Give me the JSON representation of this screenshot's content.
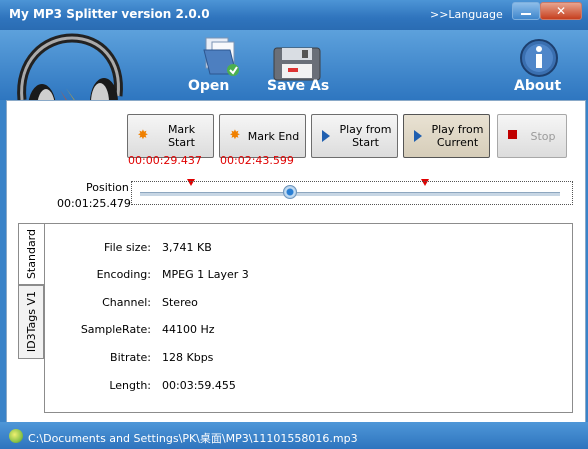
{
  "window": {
    "title": "My MP3 Splitter version 2.0.0",
    "language_label": ">>Language",
    "close_glyph": "✕"
  },
  "toolbar": {
    "open_label": "Open",
    "save_as_label": "Save As",
    "about_label": "About"
  },
  "controls": {
    "mark_start": {
      "label": "Mark Start",
      "time": "00:00:29.437"
    },
    "mark_end": {
      "label": "Mark End",
      "time": "00:02:43.599"
    },
    "play_from_start": {
      "label": "Play from Start"
    },
    "play_from_current": {
      "label": "Play from Current"
    },
    "stop": {
      "label": "Stop"
    }
  },
  "position": {
    "label": "Position",
    "time": "00:01:25.479",
    "fraction": 0.357,
    "mark_start_fraction": 0.123,
    "mark_end_fraction": 0.682
  },
  "tabs": [
    {
      "label": "Standard",
      "active": true
    },
    {
      "label": "ID3Tags V1",
      "active": false
    }
  ],
  "info": {
    "rows": [
      {
        "label": "File size:",
        "value": "3,741 KB"
      },
      {
        "label": "Encoding:",
        "value": "MPEG 1 Layer 3"
      },
      {
        "label": "Channel:",
        "value": "Stereo"
      },
      {
        "label": "SampleRate:",
        "value": "44100 Hz"
      },
      {
        "label": "Bitrate:",
        "value": "128 Kbps"
      },
      {
        "label": "Length:",
        "value": "00:03:59.455"
      }
    ]
  },
  "status": {
    "path": "C:\\Documents and Settings\\PK\\桌面\\MP3\\11101558016.mp3"
  },
  "colors": {
    "accent_blue": "#2e76c0",
    "time_red": "#e00000"
  }
}
